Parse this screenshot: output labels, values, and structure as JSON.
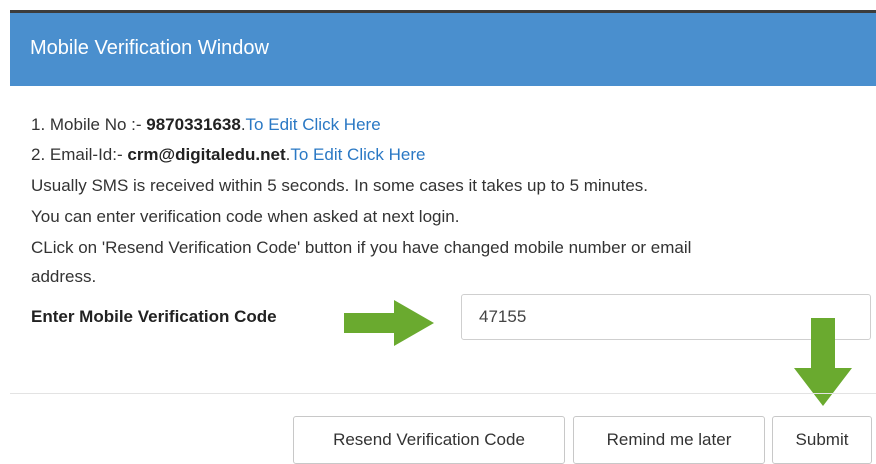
{
  "window": {
    "title": "Mobile Verification Window"
  },
  "info": {
    "mobile_prefix": "1. Mobile No :- ",
    "mobile_number": "9870331638",
    "mobile_sep": ".",
    "mobile_edit_link": "To Edit Click Here",
    "email_prefix": "2. Email-Id:- ",
    "email_value": "crm@digitaledu.net",
    "email_sep": ".",
    "email_edit_link": "To Edit Click Here",
    "line_sms": "Usually SMS is received within 5 seconds. In some cases it takes up to 5 minutes.",
    "line_next_login": "You can enter verification code when asked at next login.",
    "line_resend_1": "CLick on 'Resend Verification Code' button if you have changed mobile number or email",
    "line_resend_2": "address."
  },
  "form": {
    "code_label": "Enter Mobile Verification Code",
    "code_value": "47155"
  },
  "buttons": {
    "resend": "Resend Verification Code",
    "remind": "Remind me later",
    "submit": "Submit"
  },
  "colors": {
    "header": "#4a8fce",
    "link": "#2a78c4",
    "arrow": "#6aaa2f"
  },
  "icons": {
    "right_arrow": "arrow-right-icon",
    "down_arrow": "arrow-down-icon"
  }
}
